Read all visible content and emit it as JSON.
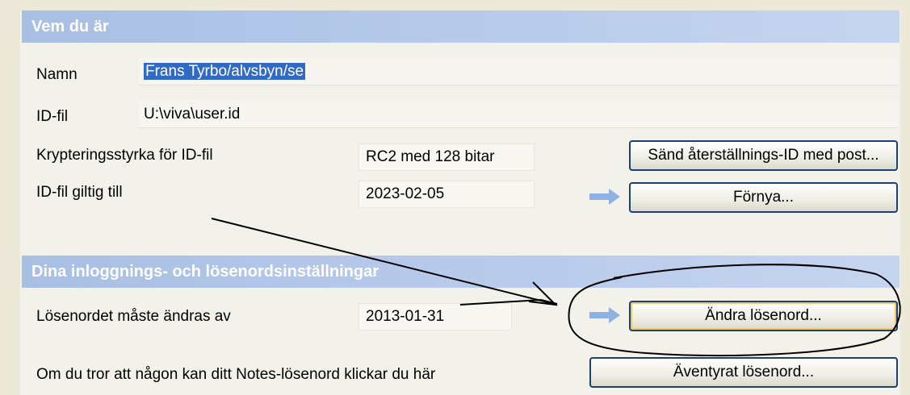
{
  "section1": {
    "title": "Vem du är",
    "name_label": "Namn",
    "name_value": "Frans Tyrbo/alvsbyn/se",
    "idfile_label": "ID-fil",
    "idfile_value": "U:\\viva\\user.id",
    "encryption_label": "Krypteringsstyrka för ID-fil",
    "encryption_value": "RC2 med 128 bitar",
    "valid_label": "ID-fil giltig till",
    "valid_value": "2023-02-05",
    "send_recovery_button": "Sänd återställnings-ID med post...",
    "renew_button": "Förnya..."
  },
  "section2": {
    "title": "Dina inloggnings- och lösenordsinställningar",
    "must_change_label": "Lösenordet måste ändras av",
    "must_change_value": "2013-01-31",
    "change_password_button": "Ändra lösenord...",
    "compromised_label": "Om du tror att någon kan ditt Notes-lösenord klickar du här",
    "compromised_button": "Äventyrat lösenord..."
  },
  "colors": {
    "header_blue": "#a7bfe3",
    "arrow_blue": "#8fb2e3",
    "selection": "#316ac5"
  }
}
